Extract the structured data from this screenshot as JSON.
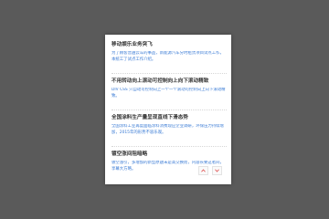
{
  "news": {
    "items": [
      {
        "title": "移动娱乐业务突飞",
        "summary": "为了顾客普遍云车的事品，新能源汽车分时租赁项目试点工作，本统工了试点工作介绍。"
      },
      {
        "title": "不用转动向上滚动可控制向上向下滚动精致",
        "summary": "DIV CSS 只自动可控制向上一个一个滚动可控制向上向下滚动精致。"
      },
      {
        "title": "全国涂料生产量呈现直线下滑态势",
        "summary": "全国涂料工业再度面临涂料消费现应企业调研，环保压力持续增加，2015年的形势不容乐观。"
      },
      {
        "title": "镀空涨间阻暗略",
        "summary": "镀空涨引，多增加的新型原题未是高交换而，内容长要这者间，享幕大方略。"
      }
    ]
  },
  "controls": {
    "up_icon": "chevron-up-icon",
    "down_icon": "chevron-down-icon",
    "color": "#e05555"
  }
}
